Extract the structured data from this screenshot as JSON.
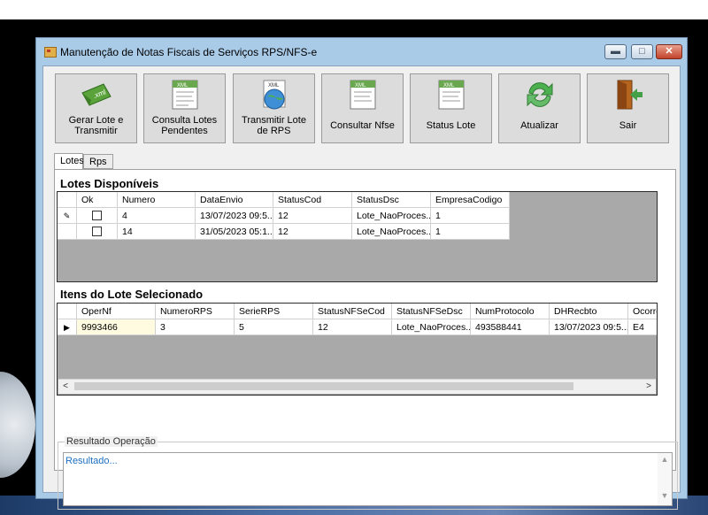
{
  "window": {
    "title": "Manutenção de Notas Fiscais de Serviços RPS/NFS-e",
    "min_label": "▬",
    "max_label": "□",
    "close_label": "✕"
  },
  "toolbar": [
    {
      "label": "Gerar Lote e Transmitir",
      "icon": "xml-envelope-icon"
    },
    {
      "label": "Consulta Lotes Pendentes",
      "icon": "xml-document-icon"
    },
    {
      "label": "Transmitir Lote de RPS",
      "icon": "xml-globe-icon"
    },
    {
      "label": "Consultar Nfse",
      "icon": "xml-document-icon"
    },
    {
      "label": "Status Lote",
      "icon": "xml-document-icon"
    },
    {
      "label": "Atualizar",
      "icon": "refresh-icon"
    },
    {
      "label": "Sair",
      "icon": "exit-door-icon"
    }
  ],
  "tabs": [
    {
      "label": "Lotes"
    },
    {
      "label": "Rps"
    }
  ],
  "lotes": {
    "title": "Lotes Disponíveis",
    "columns": [
      "Ok",
      "Numero",
      "DataEnvio",
      "StatusCod",
      "StatusDsc",
      "EmpresaCodigo"
    ],
    "rows": [
      {
        "ok": "",
        "numero": "4",
        "data": "13/07/2023 09:5...",
        "statuscod": "12",
        "statusdsc": "Lote_NaoProces...",
        "empresa": "1"
      },
      {
        "ok": "",
        "numero": "14",
        "data": "31/05/2023 05:1...",
        "statuscod": "12",
        "statusdsc": "Lote_NaoProces...",
        "empresa": "1"
      }
    ]
  },
  "itens": {
    "title": "Itens do Lote Selecionado",
    "columns": [
      "OperNf",
      "NumeroRPS",
      "SerieRPS",
      "StatusNFSeCod",
      "StatusNFSeDsc",
      "NumProtocolo",
      "DHRecbto",
      "Ocorre"
    ],
    "row": [
      "9993466",
      "3",
      "5",
      "12",
      "Lote_NaoProces...",
      "493588441",
      "13/07/2023 09:5...",
      "E4"
    ]
  },
  "resultado": {
    "label": "Resultado Operação",
    "text": "Resultado..."
  },
  "colors": {
    "window_frame": "#aacbe8",
    "grid_bg": "#a9a9a9",
    "result_text": "#1f6fbf"
  }
}
